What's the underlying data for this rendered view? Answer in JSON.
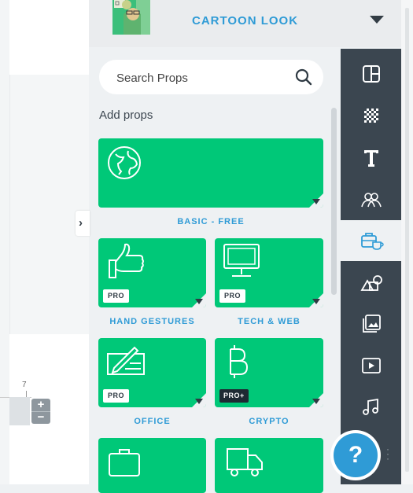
{
  "style_selector": {
    "label": "CARTOON LOOK"
  },
  "search": {
    "placeholder": "Search Props",
    "value": ""
  },
  "add_props_label": "Add props",
  "categories": [
    {
      "caption": "BASIC - FREE",
      "badge": "",
      "icon": "globe-icon"
    },
    {
      "caption": "HAND GESTURES",
      "badge": "PRO",
      "icon": "thumbs-up-icon"
    },
    {
      "caption": "TECH & WEB",
      "badge": "PRO",
      "icon": "monitor-icon"
    },
    {
      "caption": "OFFICE",
      "badge": "PRO",
      "icon": "check-writing-icon"
    },
    {
      "caption": "CRYPTO",
      "badge": "PRO+",
      "icon": "bitcoin-icon"
    },
    {
      "caption": "",
      "badge": "",
      "icon": "briefcase-icon"
    },
    {
      "caption": "",
      "badge": "",
      "icon": "truck-icon"
    }
  ],
  "sidebar": [
    {
      "name": "layout-icon",
      "active": false
    },
    {
      "name": "background-icon",
      "active": false
    },
    {
      "name": "text-icon",
      "active": false
    },
    {
      "name": "characters-icon",
      "active": false
    },
    {
      "name": "props-icon",
      "active": true
    },
    {
      "name": "shapes-icon",
      "active": false
    },
    {
      "name": "image-icon",
      "active": false
    },
    {
      "name": "video-icon",
      "active": false
    },
    {
      "name": "music-icon",
      "active": false
    }
  ],
  "ruler": {
    "number": "7"
  },
  "zoom": {
    "plus": "+",
    "minus": "−"
  },
  "help": {
    "label": "?"
  },
  "colors": {
    "accent": "#2f9bd6",
    "card": "#00c878",
    "sidebar": "#3b4650"
  }
}
